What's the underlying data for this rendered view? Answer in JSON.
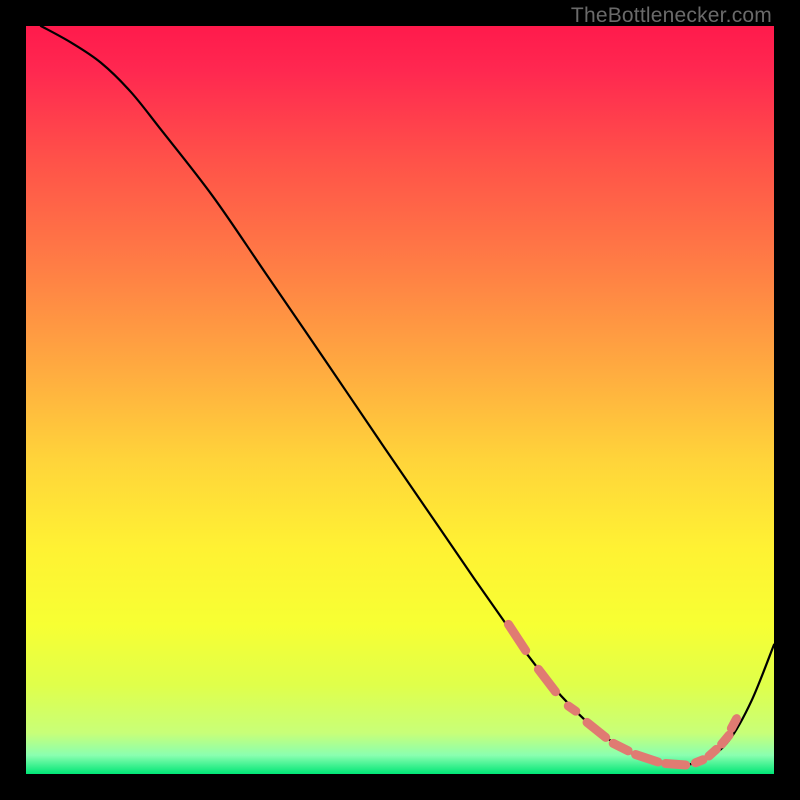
{
  "watermark": "TheBottlenecker.com",
  "chart_data": {
    "type": "line",
    "title": "",
    "xlabel": "",
    "ylabel": "",
    "xlim": [
      0,
      100
    ],
    "ylim": [
      0,
      100
    ],
    "grid": false,
    "gradient_stops": [
      {
        "offset": 0.0,
        "color": "#ff1a4c"
      },
      {
        "offset": 0.06,
        "color": "#ff2850"
      },
      {
        "offset": 0.18,
        "color": "#ff5249"
      },
      {
        "offset": 0.32,
        "color": "#ff7d45"
      },
      {
        "offset": 0.46,
        "color": "#ffab40"
      },
      {
        "offset": 0.58,
        "color": "#ffd43a"
      },
      {
        "offset": 0.7,
        "color": "#fff233"
      },
      {
        "offset": 0.8,
        "color": "#f7ff33"
      },
      {
        "offset": 0.88,
        "color": "#e0ff4a"
      },
      {
        "offset": 0.945,
        "color": "#c8ff78"
      },
      {
        "offset": 0.975,
        "color": "#8affb0"
      },
      {
        "offset": 1.0,
        "color": "#00e676"
      }
    ],
    "series": [
      {
        "name": "curve",
        "stroke": "#000000",
        "stroke_width": 2.2,
        "x": [
          2,
          6,
          10,
          14,
          18,
          25,
          32,
          40,
          48,
          55,
          60,
          64,
          67,
          70,
          73,
          76,
          79,
          82,
          85,
          88,
          91,
          94,
          97,
          100
        ],
        "y": [
          100,
          97.8,
          95.1,
          91.2,
          86.2,
          77.2,
          67.0,
          55.3,
          43.5,
          33.3,
          26.0,
          20.3,
          16.0,
          12.2,
          8.9,
          6.1,
          3.9,
          2.3,
          1.4,
          1.2,
          2.0,
          4.5,
          9.8,
          17.3
        ]
      },
      {
        "name": "optimal-zone-markers",
        "type": "scatter",
        "stroke": "#e07b72",
        "fill": "#e07b72",
        "points": [
          {
            "x1": 64.5,
            "y1": 20.0,
            "x2": 66.8,
            "y2": 16.5
          },
          {
            "x1": 68.5,
            "y1": 14.0,
            "x2": 70.8,
            "y2": 11.0
          },
          {
            "x1": 72.5,
            "y1": 9.1,
            "x2": 73.5,
            "y2": 8.4
          },
          {
            "x1": 75.0,
            "y1": 6.9,
            "x2": 77.5,
            "y2": 4.9
          },
          {
            "x1": 78.5,
            "y1": 4.1,
            "x2": 80.5,
            "y2": 3.1
          },
          {
            "x1": 81.5,
            "y1": 2.6,
            "x2": 84.5,
            "y2": 1.6
          },
          {
            "x1": 85.5,
            "y1": 1.4,
            "x2": 88.2,
            "y2": 1.2
          },
          {
            "x1": 89.5,
            "y1": 1.5,
            "x2": 90.5,
            "y2": 1.9
          },
          {
            "x1": 91.3,
            "y1": 2.4,
            "x2": 92.3,
            "y2": 3.3
          },
          {
            "x1": 93.0,
            "y1": 4.0,
            "x2": 94.0,
            "y2": 5.2
          },
          {
            "x1": 94.3,
            "y1": 6.1,
            "x2": 95.0,
            "y2": 7.4
          }
        ]
      }
    ]
  }
}
